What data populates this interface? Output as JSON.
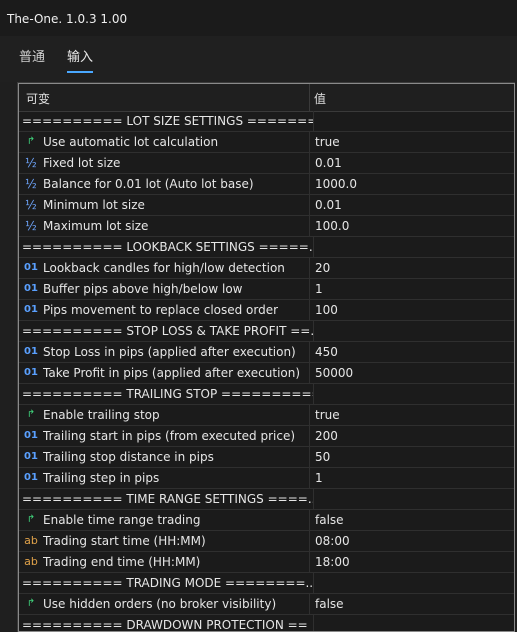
{
  "window": {
    "title": "The-One. 1.0.3 1.00"
  },
  "tabs": [
    {
      "label": "普通"
    },
    {
      "label": "输入"
    }
  ],
  "table": {
    "header_variable": "可变",
    "header_value": "值",
    "rows": [
      {
        "kind": "section",
        "label": "========== LOT SIZE SETTINGS =======..."
      },
      {
        "kind": "bool",
        "icon": "bool-icon",
        "label": "Use automatic lot calculation",
        "value": "true"
      },
      {
        "kind": "frac",
        "icon": "double-icon",
        "label": "Fixed lot size",
        "value": "0.01"
      },
      {
        "kind": "frac",
        "icon": "double-icon",
        "label": "Balance for 0.01 lot (Auto lot base)",
        "value": "1000.0"
      },
      {
        "kind": "frac",
        "icon": "double-icon",
        "label": "Minimum lot size",
        "value": "0.01"
      },
      {
        "kind": "frac",
        "icon": "double-icon",
        "label": "Maximum lot size",
        "value": "100.0"
      },
      {
        "kind": "section",
        "label": "========== LOOKBACK SETTINGS =====..."
      },
      {
        "kind": "int",
        "icon": "int-icon",
        "label": "Lookback candles for high/low detection",
        "value": "20"
      },
      {
        "kind": "int",
        "icon": "int-icon",
        "label": "Buffer pips above high/below low",
        "value": "1"
      },
      {
        "kind": "int",
        "icon": "int-icon",
        "label": "Pips movement to replace closed order",
        "value": "100"
      },
      {
        "kind": "section",
        "label": "========== STOP LOSS & TAKE PROFIT ==..."
      },
      {
        "kind": "int",
        "icon": "int-icon",
        "label": "Stop Loss in pips (applied after execution)",
        "value": "450"
      },
      {
        "kind": "int",
        "icon": "int-icon",
        "label": "Take Profit in pips (applied after execution)",
        "value": "50000"
      },
      {
        "kind": "section",
        "label": "========== TRAILING STOP =========="
      },
      {
        "kind": "bool",
        "icon": "bool-icon",
        "label": "Enable trailing stop",
        "value": "true"
      },
      {
        "kind": "int",
        "icon": "int-icon",
        "label": "Trailing start in pips (from executed price)",
        "value": "200"
      },
      {
        "kind": "int",
        "icon": "int-icon",
        "label": "Trailing stop distance in pips",
        "value": "50"
      },
      {
        "kind": "int",
        "icon": "int-icon",
        "label": "Trailing step in pips",
        "value": "1"
      },
      {
        "kind": "section",
        "label": "========== TIME RANGE SETTINGS ====..."
      },
      {
        "kind": "bool",
        "icon": "bool-icon",
        "label": "Enable time range trading",
        "value": "false"
      },
      {
        "kind": "str",
        "icon": "string-icon",
        "label": "Trading start time (HH:MM)",
        "value": "08:00"
      },
      {
        "kind": "str",
        "icon": "string-icon",
        "label": "Trading end time (HH:MM)",
        "value": "18:00"
      },
      {
        "kind": "section",
        "label": "========== TRADING MODE ========..."
      },
      {
        "kind": "bool",
        "icon": "bool-icon",
        "label": "Use hidden orders (no broker visibility)",
        "value": "false"
      },
      {
        "kind": "section",
        "label": "========== DRAWDOWN PROTECTION =="
      }
    ]
  },
  "glyphs": {
    "bool": "↱",
    "frac": "½",
    "int": "01",
    "str": "ab"
  }
}
